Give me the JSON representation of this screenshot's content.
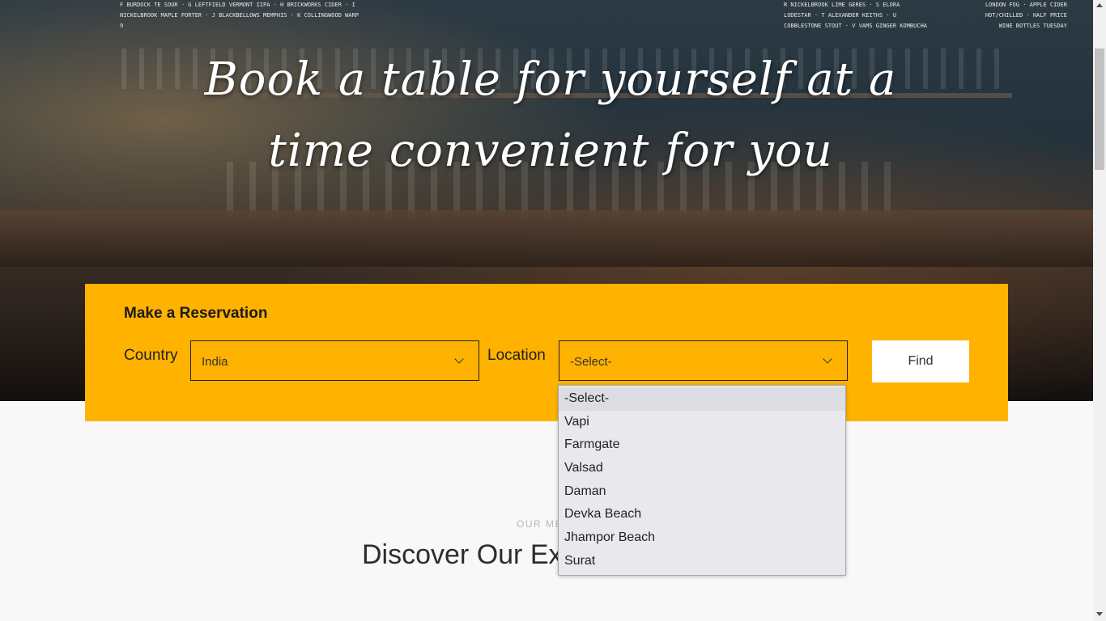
{
  "hero": {
    "title_line1": "Book a table for yourself at a",
    "title_line2": "time convenient for you",
    "chalkboard_left": "F BURDOCK TE SOUR · G LEFTFIELD VERMONT IIPA · H BRICKWORKS CIDER · I NICKELBROOK MAPLE PORTER · J BLACKBELLOWS MEMPHIS · K COLLINGWOOD WARP 9",
    "chalkboard_middle": "R NICKELBROOK LIME GERES · S ELORA LODESTAR · T ALEXANDER KEITHS · U COBBLESTONE STOUT · V VAMS GINGER KOMBUCHA",
    "chalkboard_right": "LONDON FOG · APPLE CIDER HOT/CHILLED · HALF PRICE WINE BOTTLES TUESDAY"
  },
  "reservation": {
    "heading": "Make a Reservation",
    "country_label": "Country",
    "country_value": "India",
    "location_label": "Location",
    "location_value": "-Select-",
    "find_label": "Find",
    "location_options": [
      "-Select-",
      "Vapi",
      "Farmgate",
      "Valsad",
      "Daman",
      "Devka Beach",
      "Jhampor Beach",
      "Surat"
    ]
  },
  "section": {
    "subtitle": "OUR ME",
    "title": "Discover Our Ex"
  },
  "colors": {
    "accent": "#ffb200",
    "page_background": "#f8f8f8"
  }
}
